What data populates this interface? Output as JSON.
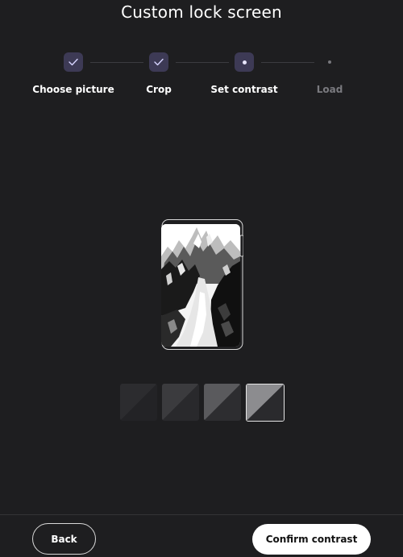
{
  "page": {
    "title": "Custom lock screen"
  },
  "stepper": {
    "steps": [
      {
        "label": "Choose picture",
        "state": "complete",
        "icon": "check-icon"
      },
      {
        "label": "Crop",
        "state": "complete",
        "icon": "check-icon"
      },
      {
        "label": "Set contrast",
        "state": "current",
        "icon": "dot-icon"
      },
      {
        "label": "Load",
        "state": "pending",
        "icon": "dot-icon"
      }
    ]
  },
  "contrast": {
    "options": [
      "contrast-1",
      "contrast-2",
      "contrast-3",
      "contrast-4"
    ],
    "selected_index": 3
  },
  "footer": {
    "back_label": "Back",
    "confirm_label": "Confirm contrast"
  },
  "colors": {
    "background": "#1e1e20",
    "step_accent": "#3d3a55",
    "primary_button": "#ffffff"
  }
}
